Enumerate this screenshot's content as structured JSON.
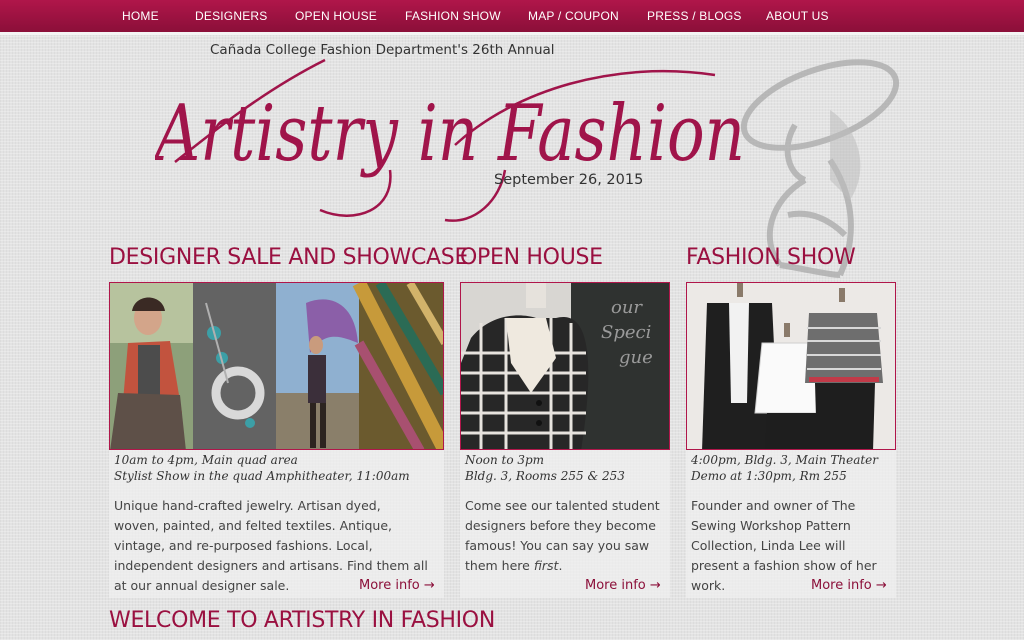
{
  "nav": {
    "items": [
      "HOME",
      "DESIGNERS",
      "OPEN HOUSE",
      "FASHION SHOW",
      "MAP / COUPON",
      "PRESS / BLOGS",
      "ABOUT US"
    ]
  },
  "header": {
    "subtitle": "Cañada College Fashion Department's 26th Annual",
    "logo_text": "Artistry in Fashion",
    "date": "September 26, 2015"
  },
  "columns": [
    {
      "title": "DESIGNER SALE AND SHOWCASE",
      "info_line1": "10am to 4pm, Main quad area",
      "info_line2": "Stylist Show in the quad Amphitheater, 11:00am",
      "desc": "Unique hand-crafted jewelry. Artisan dyed, woven, painted, and felted textiles. Antique, vintage, and re-purposed fashions. Local, independent designers and artisans. Find them all at our annual designer sale.",
      "more": "More info →"
    },
    {
      "title": "OPEN HOUSE",
      "info_line1": "Noon to 3pm",
      "info_line2": "Bldg. 3, Rooms 255 & 253",
      "desc_a": "Come see our talented student designers before they become famous! You can say you saw them here ",
      "desc_b": "first",
      "desc_c": ".",
      "more": "More info →"
    },
    {
      "title": "FASHION SHOW",
      "info_line1": "4:00pm, Bldg. 3, Main Theater",
      "info_line2": "Demo at 1:30pm, Rm 255",
      "desc": "Founder and owner of The Sewing Workshop Pattern Collection, Linda Lee will present a fashion show of her work.",
      "more": "More info →"
    }
  ],
  "welcome_title": "WELCOME TO ARTISTRY IN FASHION",
  "colors": {
    "brand": "#9a1040",
    "nav": "#8b0f39"
  }
}
